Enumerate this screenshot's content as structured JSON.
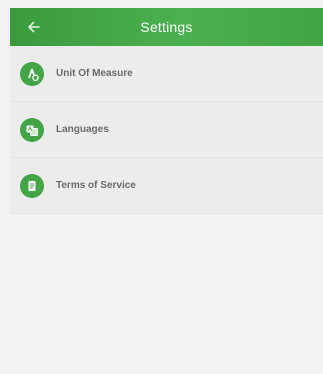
{
  "header": {
    "title": "Settings",
    "back_icon": "arrow-left-icon"
  },
  "settings": {
    "items": [
      {
        "label": "Unit Of Measure",
        "icon": "ruler-circle-icon"
      },
      {
        "label": "Languages",
        "icon": "translate-icon"
      },
      {
        "label": "Terms of Service",
        "icon": "document-icon"
      }
    ]
  },
  "colors": {
    "accent": "#43a547",
    "header": "#4bb04f",
    "row_bg": "#ececec",
    "text": "#6a6a6a"
  }
}
